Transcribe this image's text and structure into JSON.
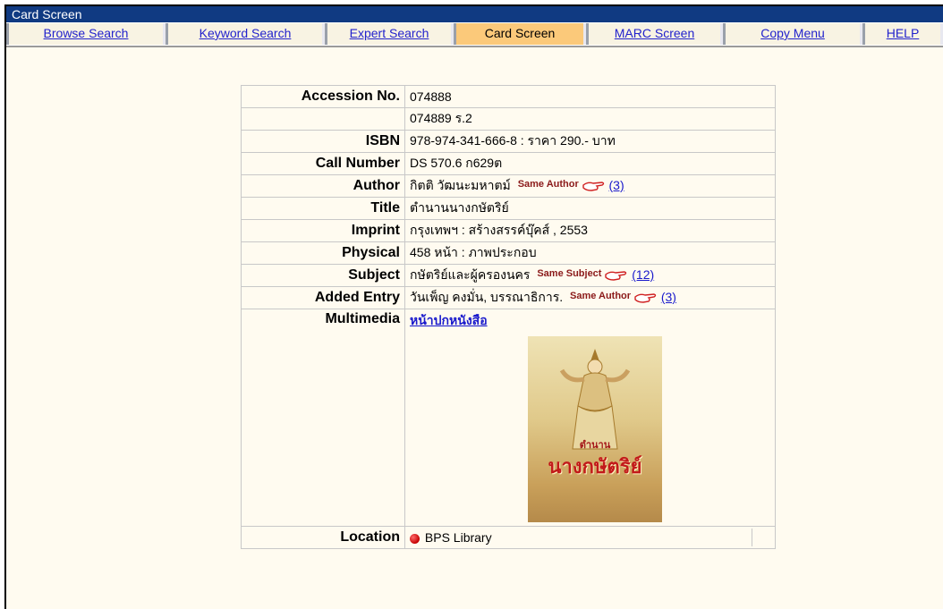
{
  "window": {
    "title": "Card Screen"
  },
  "tabs": [
    {
      "label": "Browse Search",
      "active": false
    },
    {
      "label": "Keyword Search",
      "active": false
    },
    {
      "label": "Expert Search",
      "active": false
    },
    {
      "label": "Card Screen",
      "active": true
    },
    {
      "label": "MARC Screen",
      "active": false
    },
    {
      "label": "Copy Menu",
      "active": false
    },
    {
      "label": "HELP",
      "active": false
    }
  ],
  "record": {
    "accession_label": "Accession No.",
    "accession_1": "074888",
    "accession_2": "074889 ร.2",
    "isbn_label": "ISBN",
    "isbn": "978-974-341-666-8 : ราคา 290.- บาท",
    "call_number_label": "Call Number",
    "call_number": "DS 570.6 ก629ต",
    "author_label": "Author",
    "author": "กิตติ วัฒนะมหาตม์",
    "author_same_label": "Same Author",
    "author_count": "(3)",
    "title_label": "Title",
    "title": "ตำนานนางกษัตริย์",
    "imprint_label": "Imprint",
    "imprint": "กรุงเทพฯ : สร้างสรรค์บุ๊คส์ , 2553",
    "physical_label": "Physical",
    "physical": "458 หน้า : ภาพประกอบ",
    "subject_label": "Subject",
    "subject": "กษัตริย์และผู้ครองนคร",
    "subject_same_label": "Same Subject",
    "subject_count": "(12)",
    "added_entry_label": "Added Entry",
    "added_entry": "วันเพ็ญ คงมั่น, บรรณาธิการ.",
    "added_same_label": "Same Author",
    "added_count": "(3)",
    "multimedia_label": "Multimedia",
    "multimedia_link": "หน้าปกหนังสือ",
    "cover_caption_small": "ตำนาน",
    "cover_caption": "นางกษัตริย์",
    "location_label": "Location",
    "location": "BPS Library"
  },
  "colors": {
    "titlebar": "#103a82",
    "tab_bg": "#f8f3e3",
    "tab_active": "#fbc97a",
    "link": "#1a1acc",
    "same_label": "#8b1a1a",
    "page_bg": "#fffbf0"
  },
  "icons": {
    "hand": "pointing-hand-icon",
    "location": "red-dot-icon"
  }
}
